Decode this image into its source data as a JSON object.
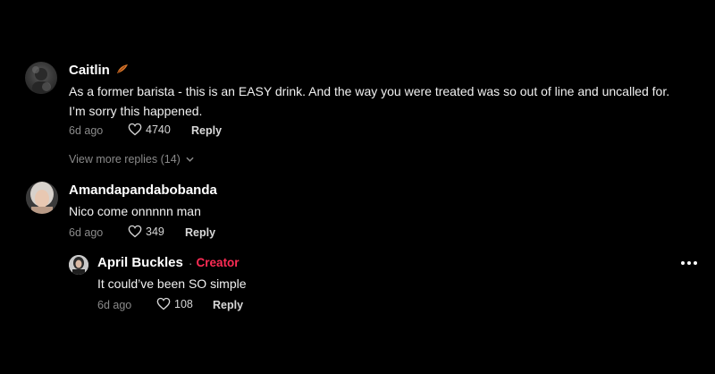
{
  "comments": [
    {
      "username": "Caitlin",
      "text": "As a former barista - this is an EASY drink. And the way you were treated was so out of line and uncalled for. I’m sorry this happened.",
      "time": "6d ago",
      "likes": "4740",
      "reply_label": "Reply",
      "view_more": "View more replies (14)"
    },
    {
      "username": "Amandapandabobanda",
      "text": "Nico come onnnnn man",
      "time": "6d ago",
      "likes": "349",
      "reply_label": "Reply"
    },
    {
      "username": "April Buckles",
      "separator": "·",
      "badge": "Creator",
      "text": "It could’ve been SO simple",
      "time": "6d ago",
      "likes": "108",
      "reply_label": "Reply"
    }
  ],
  "colors": {
    "background": "#000000",
    "creator_badge": "#fe2c55",
    "secondary_text": "#8a8a8a"
  },
  "icons": [
    "leaf-emoji-icon",
    "heart-outline-icon",
    "chevron-down-icon",
    "more-options-icon"
  ]
}
